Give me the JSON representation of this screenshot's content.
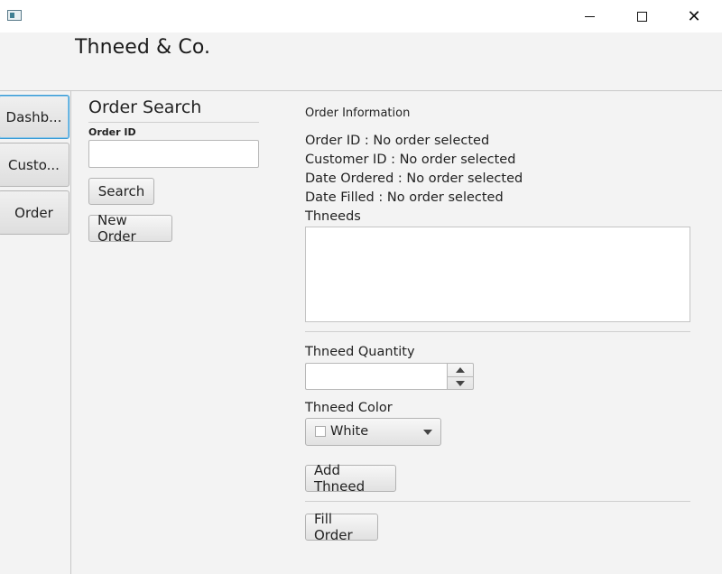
{
  "window": {
    "app_icon": "app-window-icon",
    "controls": {
      "minimize": "minimize-icon",
      "maximize": "maximize-icon",
      "close": "close-icon",
      "close_glyph": "✕"
    }
  },
  "header": {
    "title": "Thneed & Co."
  },
  "sidebar": {
    "items": [
      {
        "label": "Dashb..."
      },
      {
        "label": "Custo..."
      },
      {
        "label": "Order"
      }
    ],
    "active_index": 0,
    "active_border_color": "#3a9bd5"
  },
  "search": {
    "title": "Order Search",
    "order_id_label": "Order ID",
    "order_id_value": "",
    "search_label": "Search",
    "new_order_label": "New Order"
  },
  "info": {
    "title": "Order Information",
    "order_id_line": "Order ID : No order selected",
    "customer_id_line": "Customer ID : No order selected",
    "date_ordered_line": "Date Ordered : No order selected",
    "date_filled_line": "Date Filled : No order selected",
    "thneeds_label": "Thneeds",
    "thneeds_items": []
  },
  "form": {
    "quantity_label": "Thneed Quantity",
    "quantity_value": "",
    "color_label": "Thneed Color",
    "color_value": "White",
    "color_swatch": "#ffffff",
    "add_thneed_label": "Add Thneed",
    "fill_order_label": "Fill Order"
  }
}
